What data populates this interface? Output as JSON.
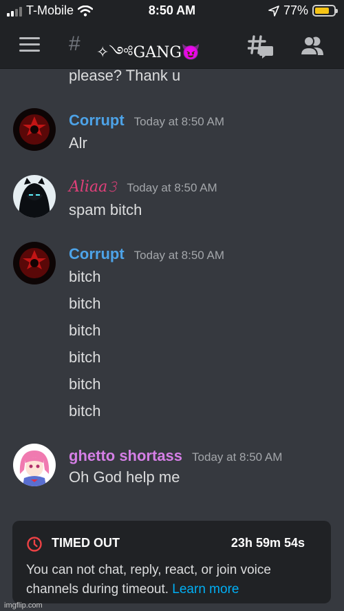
{
  "status_bar": {
    "carrier": "T-Mobile",
    "time": "8:50 AM",
    "battery_percent": "77%",
    "battery_level": 0.77
  },
  "header": {
    "hash": "#",
    "channel_name": "✧༺GANG😈"
  },
  "messages": {
    "partial_text": "please? Thank u",
    "m1": {
      "username": "Corrupt",
      "timestamp": "Today at 8:50 AM",
      "text": "Alr",
      "color": "#4da3e8"
    },
    "m2": {
      "username": "𝐴𝑙𝑖𝑎𝑎𝟹",
      "timestamp": "Today at 8:50 AM",
      "text": "spam bitch",
      "color": "#e0407a"
    },
    "m3": {
      "username": "Corrupt",
      "timestamp": "Today at 8:50 AM",
      "lines": [
        "bitch",
        "bitch",
        "bitch",
        "bitch",
        "bitch",
        "bitch"
      ],
      "color": "#4da3e8"
    },
    "m4": {
      "username": "ghetto shortass",
      "timestamp": "Today at 8:50 AM",
      "text": "Oh God help me",
      "color": "#d57fe6"
    }
  },
  "timeout": {
    "title": "TIMED OUT",
    "remaining": "23h 59m 54s",
    "description": "You can not chat, reply, react, or join voice channels during timeout.",
    "link": "Learn more"
  },
  "icons": {
    "menu": "hamburger-menu-icon",
    "threads": "threads-icon",
    "members": "members-icon",
    "clock": "clock-icon"
  },
  "watermark": "imgflip.com"
}
